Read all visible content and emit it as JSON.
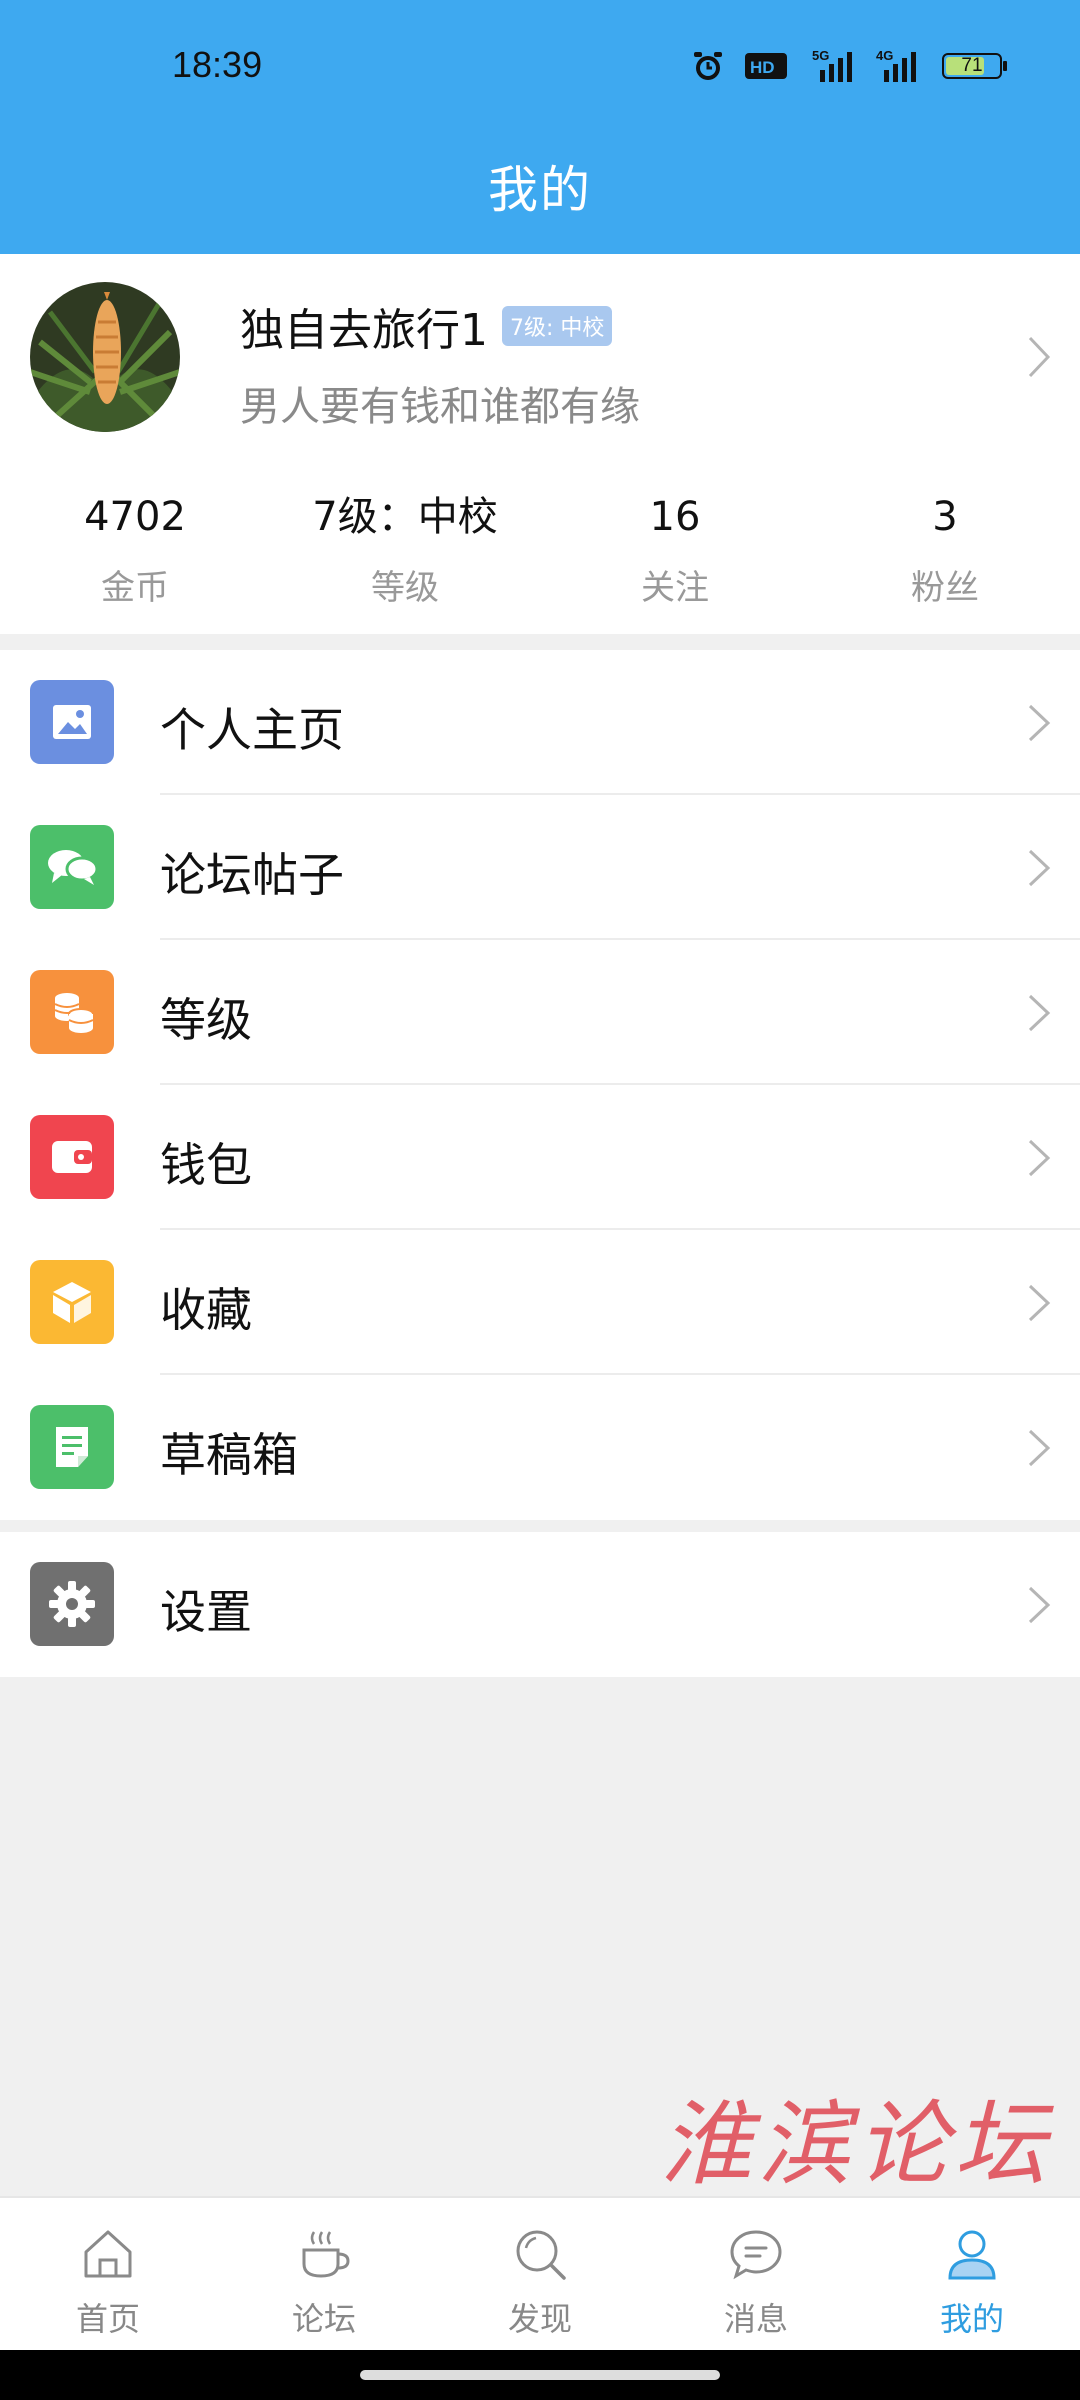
{
  "status_bar": {
    "time": "18:39",
    "battery": "71",
    "icons": [
      "alarm-icon",
      "hd-icon",
      "5g-signal-icon",
      "4g-signal-icon",
      "battery-icon"
    ]
  },
  "header": {
    "title": "我的"
  },
  "profile": {
    "username": "独自去旅行1",
    "level_badge": "7级: 中校",
    "signature": "男人要有钱和谁都有缘",
    "stats": [
      {
        "value": "4702",
        "label": "金币"
      },
      {
        "value": "7级：中校",
        "label": "等级"
      },
      {
        "value": "16",
        "label": "关注"
      },
      {
        "value": "3",
        "label": "粉丝"
      }
    ]
  },
  "menu": {
    "items": [
      {
        "label": "个人主页",
        "icon": "image-icon",
        "color": "#6b8fe0"
      },
      {
        "label": "论坛帖子",
        "icon": "chat-icon",
        "color": "#4cbf6a"
      },
      {
        "label": "等级",
        "icon": "coins-icon",
        "color": "#f7913d"
      },
      {
        "label": "钱包",
        "icon": "wallet-icon",
        "color": "#f0454f"
      },
      {
        "label": "收藏",
        "icon": "box-icon",
        "color": "#fbb833"
      },
      {
        "label": "草稿箱",
        "icon": "draft-icon",
        "color": "#4cbf6a"
      }
    ],
    "settings": {
      "label": "设置",
      "icon": "gear-icon",
      "color": "#707070"
    }
  },
  "watermark": "淮滨论坛",
  "bottom_nav": {
    "items": [
      {
        "label": "首页",
        "icon": "home-icon"
      },
      {
        "label": "论坛",
        "icon": "coffee-cup-icon"
      },
      {
        "label": "发现",
        "icon": "search-icon"
      },
      {
        "label": "消息",
        "icon": "message-icon"
      },
      {
        "label": "我的",
        "icon": "user-icon",
        "active": true
      }
    ]
  },
  "colors": {
    "header": "#3ea9f0",
    "accent": "#2f9de0"
  }
}
